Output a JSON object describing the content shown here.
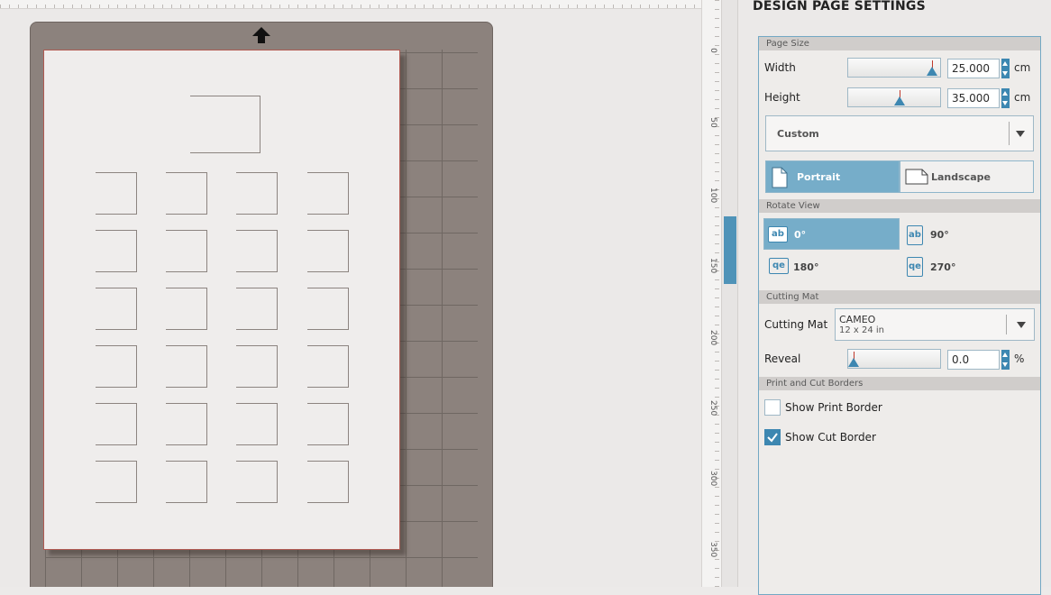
{
  "canvas": {
    "ruler_numbers": [
      "0",
      "50",
      "100",
      "150",
      "200",
      "250",
      "300",
      "350"
    ]
  },
  "panel": {
    "title": "DESIGN PAGE SETTINGS",
    "page_size": {
      "section": "Page Size",
      "width_label": "Width",
      "width_value": "25.000",
      "height_label": "Height",
      "height_value": "35.000",
      "unit": "cm",
      "preset": "Custom",
      "portrait_label": "Portrait",
      "landscape_label": "Landscape"
    },
    "rotate_view": {
      "section": "Rotate View",
      "options": [
        "0°",
        "90°",
        "180°",
        "270°"
      ]
    },
    "cutting_mat": {
      "section": "Cutting Mat",
      "label": "Cutting Mat",
      "value": "CAMEO",
      "value_sub": "12 x 24 in",
      "reveal_label": "Reveal",
      "reveal_value": "0.0",
      "reveal_unit": "%"
    },
    "borders": {
      "section": "Print and Cut Borders",
      "show_print_border": "Show Print Border",
      "show_cut_border": "Show Cut Border"
    }
  },
  "colors": {
    "accent": "#3d87b1",
    "active_segment": "#76adc9",
    "mat": "#8c827d",
    "page": "#efedec"
  }
}
